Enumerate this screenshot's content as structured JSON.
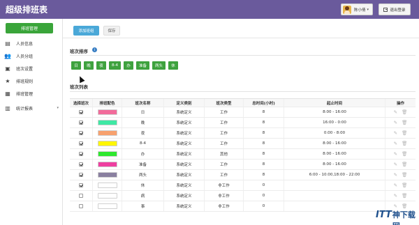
{
  "app": {
    "title": "超级排班表"
  },
  "header": {
    "user_name": "陈小倩",
    "user_caret": "▾",
    "logout_label": "退出登录"
  },
  "sidebar": {
    "primary_button": "排班管理",
    "items": [
      {
        "label": "人员信息",
        "icon": "id-card-icon",
        "glyph": "▤"
      },
      {
        "label": "人员分组",
        "icon": "users-icon",
        "glyph": "👥"
      },
      {
        "label": "班次设置",
        "icon": "shift-icon",
        "glyph": "▣"
      },
      {
        "label": "排班规则",
        "icon": "star-icon",
        "glyph": "★"
      },
      {
        "label": "排班管理",
        "icon": "calendar-icon",
        "glyph": "▦"
      },
      {
        "label": "统计报表",
        "icon": "chart-icon",
        "glyph": "▥",
        "chevron": "▾"
      }
    ]
  },
  "toolbar": {
    "add_label": "添加班组",
    "save_label": "保存"
  },
  "shift_order": {
    "title": "班次排序",
    "info_glyph": "i",
    "chips": [
      "日",
      "晚",
      "夜",
      "8-4",
      "办",
      "准备",
      "两头",
      "休"
    ]
  },
  "shift_list": {
    "title": "班次列表",
    "columns": [
      "选择班次",
      "排班配色",
      "班次名称",
      "定义类别",
      "班次类型",
      "总时间(小时)",
      "起止时间",
      "操作"
    ],
    "rows": [
      {
        "checked": true,
        "color": "#f26b9b",
        "name": "日",
        "category": "系统定义",
        "type": "工作",
        "hours": "8",
        "time": "8:00 - 16:00"
      },
      {
        "checked": true,
        "color": "#3fe8a4",
        "name": "晚",
        "category": "系统定义",
        "type": "工作",
        "hours": "8",
        "time": "16:00 - 0:00"
      },
      {
        "checked": true,
        "color": "#f7a16e",
        "name": "夜",
        "category": "系统定义",
        "type": "工作",
        "hours": "8",
        "time": "0:00 - 8:00"
      },
      {
        "checked": true,
        "color": "#fff600",
        "name": "8-4",
        "category": "系统定义",
        "type": "工作",
        "hours": "8",
        "time": "8:00 - 16:00"
      },
      {
        "checked": true,
        "color": "#2ee82e",
        "name": "办",
        "category": "系统定义",
        "type": "其他",
        "hours": "8",
        "time": "8:00 - 16:00"
      },
      {
        "checked": true,
        "color": "#ee3fa0",
        "name": "准备",
        "category": "系统定义",
        "type": "工作",
        "hours": "8",
        "time": "8:00 - 16:00"
      },
      {
        "checked": true,
        "color": "#8a80a0",
        "name": "两头",
        "category": "系统定义",
        "type": "工作",
        "hours": "8",
        "time": "6:00 - 10:00,18:00 - 22:00"
      },
      {
        "checked": true,
        "color": "#ffffff",
        "name": "休",
        "category": "系统定义",
        "type": "非工作",
        "hours": "0",
        "time": ""
      },
      {
        "checked": false,
        "color": "#ffffff",
        "name": "病",
        "category": "系统定义",
        "type": "非工作",
        "hours": "0",
        "time": ""
      },
      {
        "checked": false,
        "color": "#ffffff",
        "name": "事",
        "category": "系统定义",
        "type": "非工作",
        "hours": "0",
        "time": ""
      }
    ],
    "edit_icon": "✎",
    "delete_icon": "🗑"
  },
  "watermark": {
    "logo": "ITT",
    "text": "神下载网"
  },
  "colors": {
    "header_bg": "#6a5a9c",
    "primary_green": "#3aa53a",
    "add_blue": "#4aa8d8"
  }
}
